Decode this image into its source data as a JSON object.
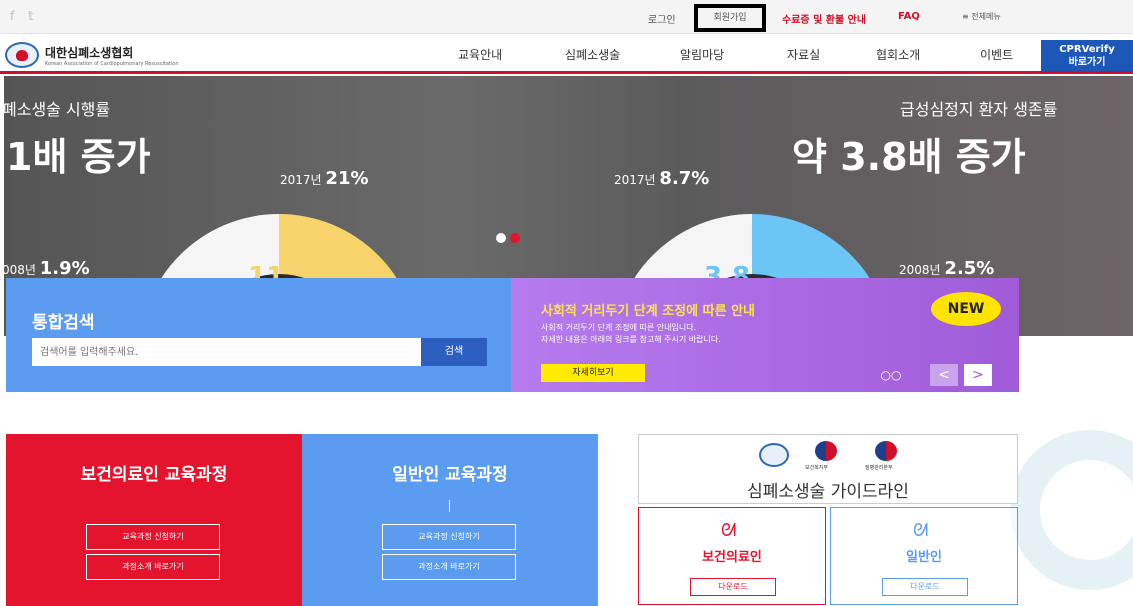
{
  "topbar": {
    "sns": [
      "f",
      "𝕥"
    ],
    "login": "로그인",
    "join": "회원가입",
    "certificate": "수료증 및 환불 안내",
    "faq": "FAQ",
    "all_menu": "≡ 전체메뉴"
  },
  "header": {
    "logo_ko": "대한심폐소생협회",
    "logo_en": "Korean Association of Cardiopulmonary Resuscitation",
    "menu": [
      "교육안내",
      "심폐소생술",
      "알림마당",
      "자료실",
      "협회소개",
      "이벤트"
    ],
    "cpr_line1": "CPRVerify",
    "cpr_line2": "바로가기"
  },
  "hero": {
    "left_title": "폐소생술 시행률",
    "left_big": "1배 증가",
    "left_2017": "2017년",
    "left_2017_val": "21%",
    "left_2008": "008년",
    "left_2008_val": "1.9%",
    "left_center": "11",
    "right_title": "급성심정지 환자 생존률",
    "right_big": "약 3.8배 증가",
    "right_2017": "2017년",
    "right_2017_val": "8.7%",
    "right_2008": "2008년",
    "right_2008_val": "2.5%",
    "right_center": "3.8",
    "left_fill": 0.21,
    "right_fill": 0.87
  },
  "search": {
    "title": "통합검색",
    "placeholder": "검색어를 입력해주세요.",
    "button": "검색"
  },
  "notice": {
    "title": "사회적 거리두기 단계 조정에 따른 안내",
    "line1": "사회적 거리두기 단계 조정에 따른 안내입니다.",
    "line2": "자세한 내용은 아래의 링크를 참고해 주시기 바랍니다.",
    "more": "자세히보기",
    "new": "NEW",
    "dots": "○○",
    "prev": "<",
    "next": ">"
  },
  "cards": {
    "pro_title": "보건의료인 교육과정",
    "pro_btn1": "교육과정 신청하기",
    "pro_btn2": "과정소개 바로가기",
    "gen_title": "일반인 교육과정",
    "gen_btn1": "교육과정 신청하기",
    "gen_btn2": "과정소개 바로가기"
  },
  "guide": {
    "logo1": "보건복지부",
    "logo2": "질병관리본부",
    "title": "심폐소생술 가이드라인",
    "pro": "보건의료인",
    "gen": "일반인",
    "download": "다운로드"
  },
  "colors": {
    "red": "#e5142e",
    "blue": "#5b9bf0",
    "yellow_donut": "#f7d36b",
    "blue_donut": "#6bc5f5"
  }
}
